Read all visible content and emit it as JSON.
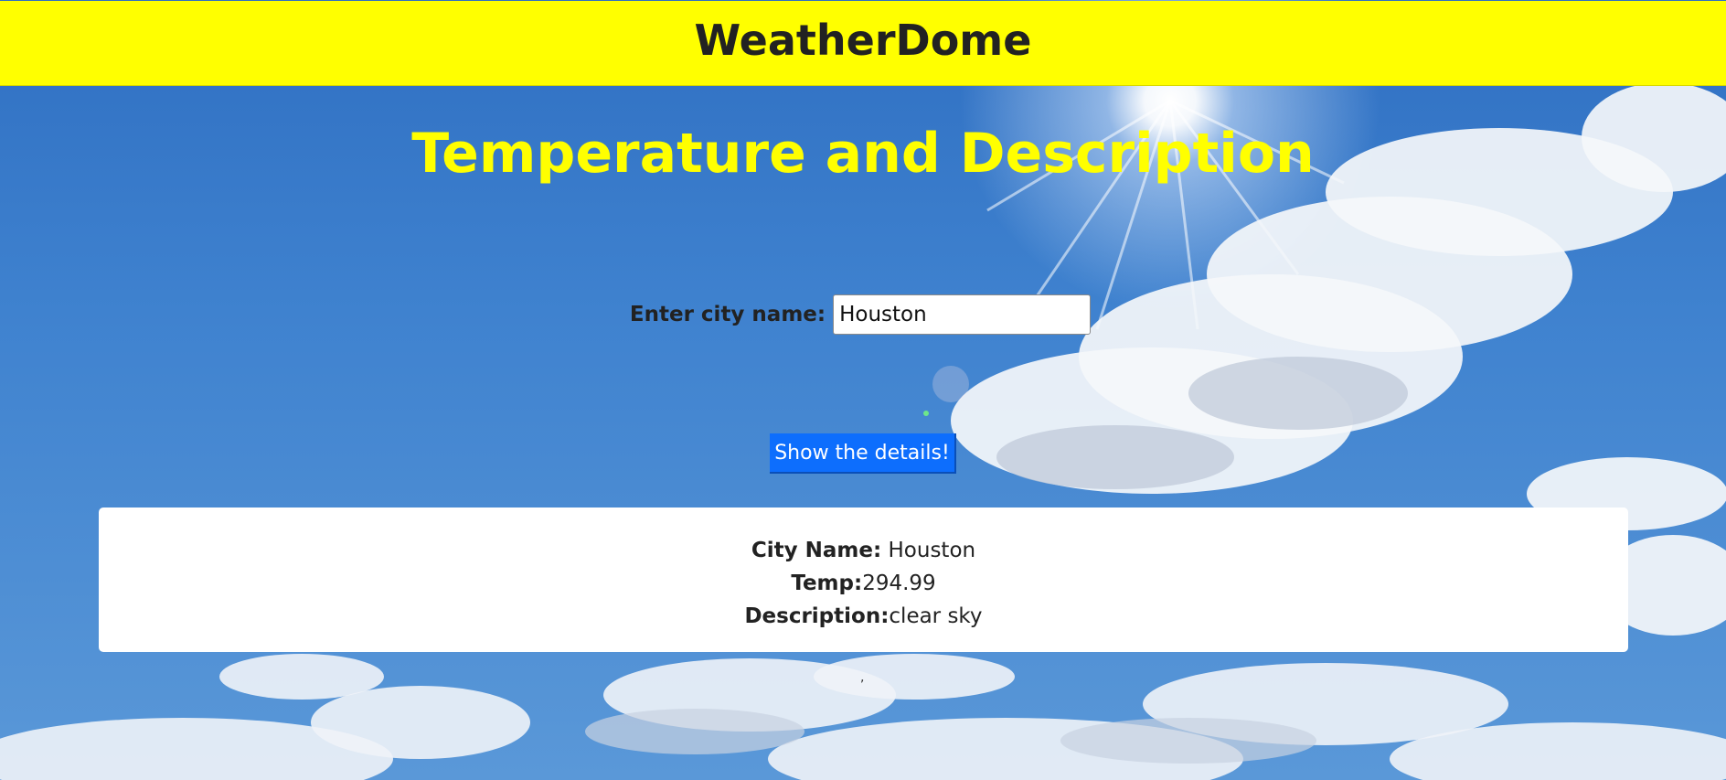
{
  "header": {
    "title": "WeatherDome",
    "background_color": "#ffff00"
  },
  "main": {
    "heading": "Temperature and Description",
    "heading_color": "#ffff00",
    "city_label": "Enter city name:",
    "city_input_value": "Houston",
    "submit_label": "Show the details!",
    "submit_color": "#0d6efd"
  },
  "result": {
    "city_label": "City Name:",
    "city_value": "Houston",
    "temp_label": "Temp:",
    "temp_value": "294.99",
    "description_label": "Description:",
    "description_value": "clear sky"
  },
  "footer": {
    "stray_mark": ","
  },
  "icons": {
    "background": "sky-clouds-sun-image"
  }
}
